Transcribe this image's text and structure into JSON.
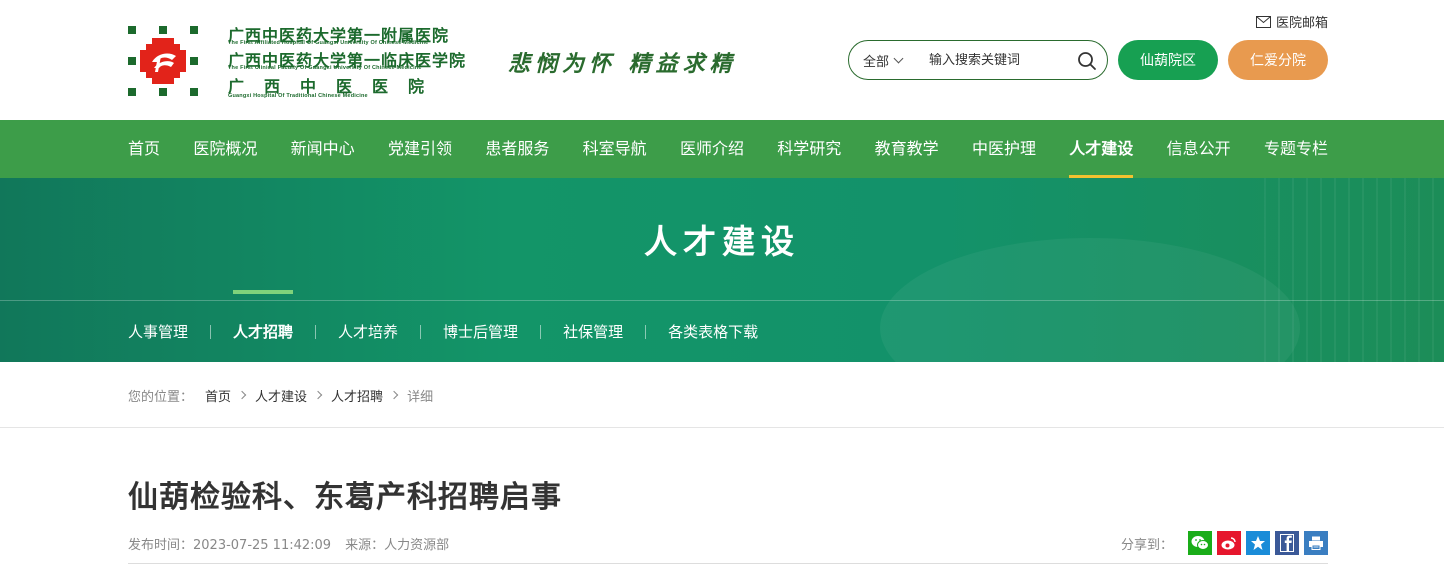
{
  "header": {
    "logo": {
      "line1_cn": "广西中医药大学第一附属医院",
      "line1_en": "The First Affiliated Hospital Of Guangxi University Of Chinese Medicine",
      "line2_cn": "广西中医药大学第一临床医学院",
      "line2_en": "The First Clinical Faculty Of Guangxi University Of Chinese Medicine",
      "line3_cn": "广西中医医院",
      "line3_en": "Guangxi Hospital Of Traditional Chinese Medicine"
    },
    "slogan": "悲悯为怀 精益求精",
    "mailbox_label": "医院邮箱",
    "search": {
      "scope": "全部",
      "placeholder": "输入搜索关键词"
    },
    "campus_buttons": [
      "仙葫院区",
      "仁爱分院"
    ]
  },
  "nav": {
    "items": [
      "首页",
      "医院概况",
      "新闻中心",
      "党建引领",
      "患者服务",
      "科室导航",
      "医师介绍",
      "科学研究",
      "教育教学",
      "中医护理",
      "人才建设",
      "信息公开",
      "专题专栏"
    ],
    "active": "人才建设"
  },
  "banner": {
    "title": "人才建设",
    "subnav": [
      "人事管理",
      "人才招聘",
      "人才培养",
      "博士后管理",
      "社保管理",
      "各类表格下载"
    ],
    "active": "人才招聘"
  },
  "breadcrumb": {
    "label": "您的位置：",
    "items": [
      "首页",
      "人才建设",
      "人才招聘",
      "详细"
    ]
  },
  "article": {
    "title": "仙葫检验科、东葛产科招聘启事",
    "publish_time": "发布时间：2023-07-25 11:42:09",
    "source": "来源：人力资源部",
    "share_label": "分享到："
  },
  "colors": {
    "nav_green": "#3d9d49",
    "accent_yellow": "#f2c230",
    "campus_1": "#17a052",
    "campus_2": "#e89a4f",
    "wechat": "#1aad19",
    "weibo": "#e6162d",
    "qzone": "#1a8cd8",
    "facebook": "#3b5998",
    "print": "#3a7ec1"
  }
}
